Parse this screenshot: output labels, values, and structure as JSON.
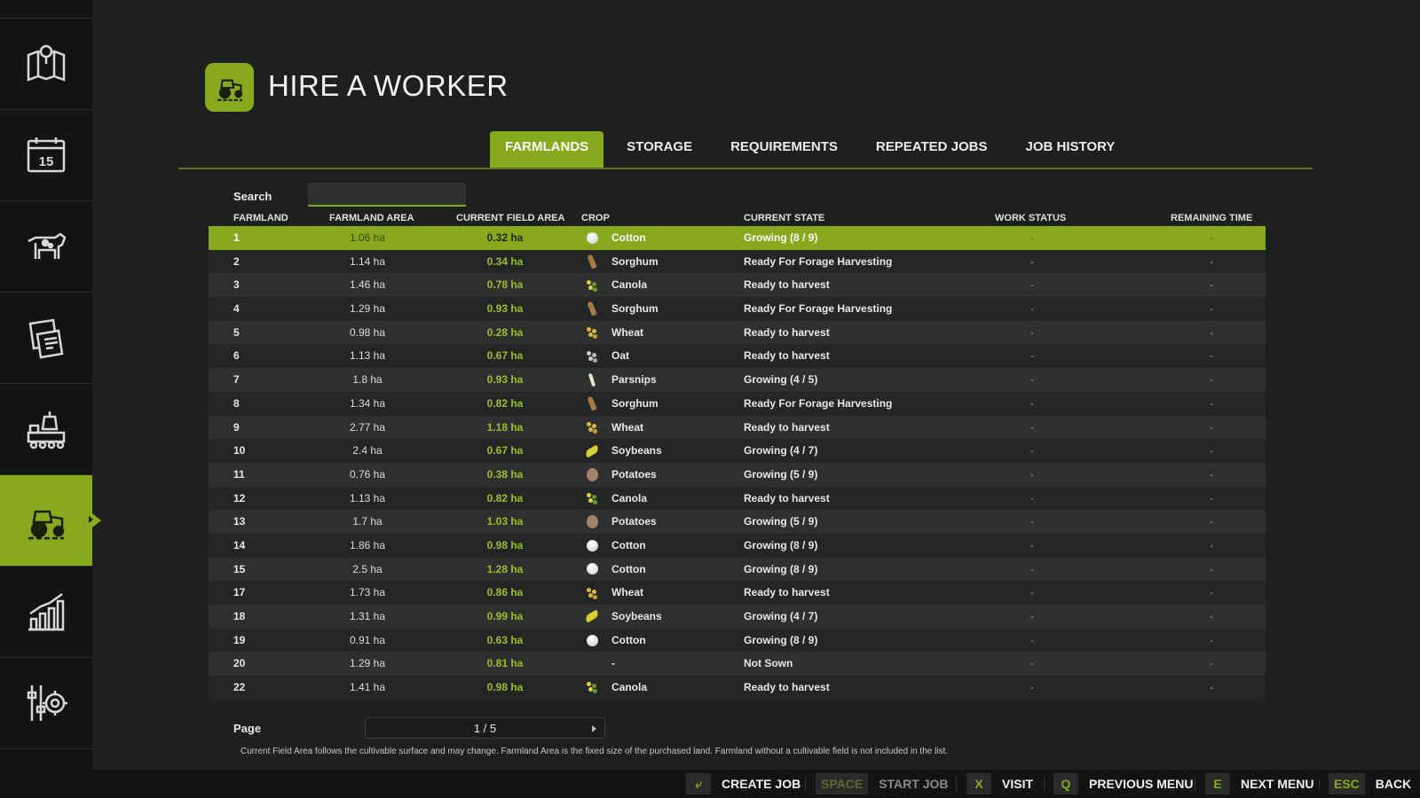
{
  "sidebar": {
    "items": [
      {
        "icon": "map-icon"
      },
      {
        "icon": "calendar-icon",
        "badge": "15"
      },
      {
        "icon": "cow-icon"
      },
      {
        "icon": "contracts-icon"
      },
      {
        "icon": "production-icon"
      },
      {
        "icon": "tractor-icon",
        "active": true
      },
      {
        "icon": "statistics-icon"
      },
      {
        "icon": "settings-icon"
      }
    ]
  },
  "header": {
    "title": "HIRE A WORKER",
    "icon": "tractor-icon"
  },
  "tabs": [
    {
      "label": "FARMLANDS",
      "active": true
    },
    {
      "label": "STORAGE"
    },
    {
      "label": "REQUIREMENTS"
    },
    {
      "label": "REPEATED JOBS"
    },
    {
      "label": "JOB HISTORY"
    }
  ],
  "search": {
    "label": "Search",
    "value": ""
  },
  "table": {
    "headers": {
      "farmland": "FARMLAND",
      "farmland_area": "FARMLAND AREA",
      "current_field_area": "CURRENT FIELD AREA",
      "crop": "CROP",
      "current_state": "CURRENT STATE",
      "work_status": "WORK STATUS",
      "remaining_time": "REMAINING TIME"
    },
    "rows": [
      {
        "farmland": "1",
        "area": "1.06 ha",
        "field": "0.32 ha",
        "icon": "cotton",
        "crop": "Cotton",
        "state": "Growing (8 / 9)",
        "work": "-",
        "remaining": "-",
        "selected": true
      },
      {
        "farmland": "2",
        "area": "1.14 ha",
        "field": "0.34 ha",
        "icon": "sorghum",
        "crop": "Sorghum",
        "state": "Ready For Forage Harvesting",
        "work": "-",
        "remaining": "-"
      },
      {
        "farmland": "3",
        "area": "1.46 ha",
        "field": "0.78 ha",
        "icon": "canola",
        "crop": "Canola",
        "state": "Ready to harvest",
        "work": "-",
        "remaining": "-"
      },
      {
        "farmland": "4",
        "area": "1.29 ha",
        "field": "0.93 ha",
        "icon": "sorghum",
        "crop": "Sorghum",
        "state": "Ready For Forage Harvesting",
        "work": "-",
        "remaining": "-"
      },
      {
        "farmland": "5",
        "area": "0.98 ha",
        "field": "0.28 ha",
        "icon": "wheat",
        "crop": "Wheat",
        "state": "Ready to harvest",
        "work": "-",
        "remaining": "-"
      },
      {
        "farmland": "6",
        "area": "1.13 ha",
        "field": "0.67 ha",
        "icon": "oat",
        "crop": "Oat",
        "state": "Ready to harvest",
        "work": "-",
        "remaining": "-"
      },
      {
        "farmland": "7",
        "area": "1.8 ha",
        "field": "0.93 ha",
        "icon": "parsnip",
        "crop": "Parsnips",
        "state": "Growing (4 / 5)",
        "work": "-",
        "remaining": "-"
      },
      {
        "farmland": "8",
        "area": "1.34 ha",
        "field": "0.82 ha",
        "icon": "sorghum",
        "crop": "Sorghum",
        "state": "Ready For Forage Harvesting",
        "work": "-",
        "remaining": "-"
      },
      {
        "farmland": "9",
        "area": "2.77 ha",
        "field": "1.18 ha",
        "icon": "wheat",
        "crop": "Wheat",
        "state": "Ready to harvest",
        "work": "-",
        "remaining": "-"
      },
      {
        "farmland": "10",
        "area": "2.4 ha",
        "field": "0.67 ha",
        "icon": "soybean",
        "crop": "Soybeans",
        "state": "Growing (4 / 7)",
        "work": "-",
        "remaining": "-"
      },
      {
        "farmland": "11",
        "area": "0.76 ha",
        "field": "0.38 ha",
        "icon": "potato",
        "crop": "Potatoes",
        "state": "Growing (5 / 9)",
        "work": "-",
        "remaining": "-"
      },
      {
        "farmland": "12",
        "area": "1.13 ha",
        "field": "0.82 ha",
        "icon": "canola",
        "crop": "Canola",
        "state": "Ready to harvest",
        "work": "-",
        "remaining": "-"
      },
      {
        "farmland": "13",
        "area": "1.7 ha",
        "field": "1.03 ha",
        "icon": "potato",
        "crop": "Potatoes",
        "state": "Growing (5 / 9)",
        "work": "-",
        "remaining": "-"
      },
      {
        "farmland": "14",
        "area": "1.86 ha",
        "field": "0.98 ha",
        "icon": "cotton",
        "crop": "Cotton",
        "state": "Growing (8 / 9)",
        "work": "-",
        "remaining": "-"
      },
      {
        "farmland": "15",
        "area": "2.5 ha",
        "field": "1.28 ha",
        "icon": "cotton",
        "crop": "Cotton",
        "state": "Growing (8 / 9)",
        "work": "-",
        "remaining": "-"
      },
      {
        "farmland": "17",
        "area": "1.73 ha",
        "field": "0.86 ha",
        "icon": "wheat",
        "crop": "Wheat",
        "state": "Ready to harvest",
        "work": "-",
        "remaining": "-"
      },
      {
        "farmland": "18",
        "area": "1.31 ha",
        "field": "0.99 ha",
        "icon": "soybean",
        "crop": "Soybeans",
        "state": "Growing (4 / 7)",
        "work": "-",
        "remaining": "-"
      },
      {
        "farmland": "19",
        "area": "0.91 ha",
        "field": "0.63 ha",
        "icon": "cotton",
        "crop": "Cotton",
        "state": "Growing (8 / 9)",
        "work": "-",
        "remaining": "-"
      },
      {
        "farmland": "20",
        "area": "1.29 ha",
        "field": "0.81 ha",
        "icon": "",
        "crop": "-",
        "state": "Not Sown",
        "work": "-",
        "remaining": "-"
      },
      {
        "farmland": "22",
        "area": "1.41 ha",
        "field": "0.98 ha",
        "icon": "canola",
        "crop": "Canola",
        "state": "Ready to harvest",
        "work": "-",
        "remaining": "-"
      }
    ]
  },
  "pagination": {
    "label": "Page",
    "value": "1 / 5"
  },
  "footnote": "Current Field Area follows the cultivable surface and may change. Farmland Area is the fixed size of the purchased land. Farmland without a cultivable field is not included in the list.",
  "bottom_bar": [
    {
      "key": "⤶",
      "label": "CREATE JOB",
      "enabled": true
    },
    {
      "key": "SPACE",
      "label": "START JOB",
      "enabled": false
    },
    {
      "key": "X",
      "label": "VISIT",
      "enabled": true
    },
    {
      "key": "Q",
      "label": "PREVIOUS MENU",
      "enabled": true
    },
    {
      "key": "E",
      "label": "NEXT MENU",
      "enabled": true
    },
    {
      "key": "ESC",
      "label": "BACK",
      "enabled": true
    }
  ],
  "colors": {
    "accent": "#87a91d",
    "background": "#1e1f1f",
    "sidebar": "#121313"
  }
}
